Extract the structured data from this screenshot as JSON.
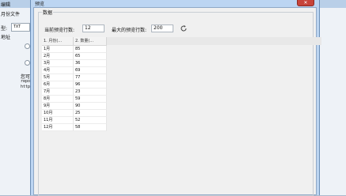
{
  "background_window": {
    "title": "编辑",
    "file_label": "月份文件",
    "type_label": "型:",
    "type_value": "TXT",
    "address_label": "地址",
    "hint_text": "您可",
    "line1": "repo",
    "line2": "http"
  },
  "dialog": {
    "title": "预览",
    "close_label": "✕",
    "group_title": "数据",
    "current_rows_label": "当前预览行数:",
    "current_rows_value": "12",
    "max_rows_label": "最大的预览行数:",
    "max_rows_value": "200",
    "refresh_icon": "refresh-icon"
  },
  "table": {
    "columns": [
      "1. 月份(...",
      "2. 数量(..."
    ],
    "rows": [
      [
        "1月",
        "85"
      ],
      [
        "2月",
        "65"
      ],
      [
        "3月",
        "36"
      ],
      [
        "4月",
        "69"
      ],
      [
        "5月",
        "77"
      ],
      [
        "6月",
        "96"
      ],
      [
        "7月",
        "23"
      ],
      [
        "8月",
        "59"
      ],
      [
        "9月",
        "90"
      ],
      [
        "10月",
        "25"
      ],
      [
        "11月",
        "52"
      ],
      [
        "12月",
        "58"
      ]
    ]
  }
}
